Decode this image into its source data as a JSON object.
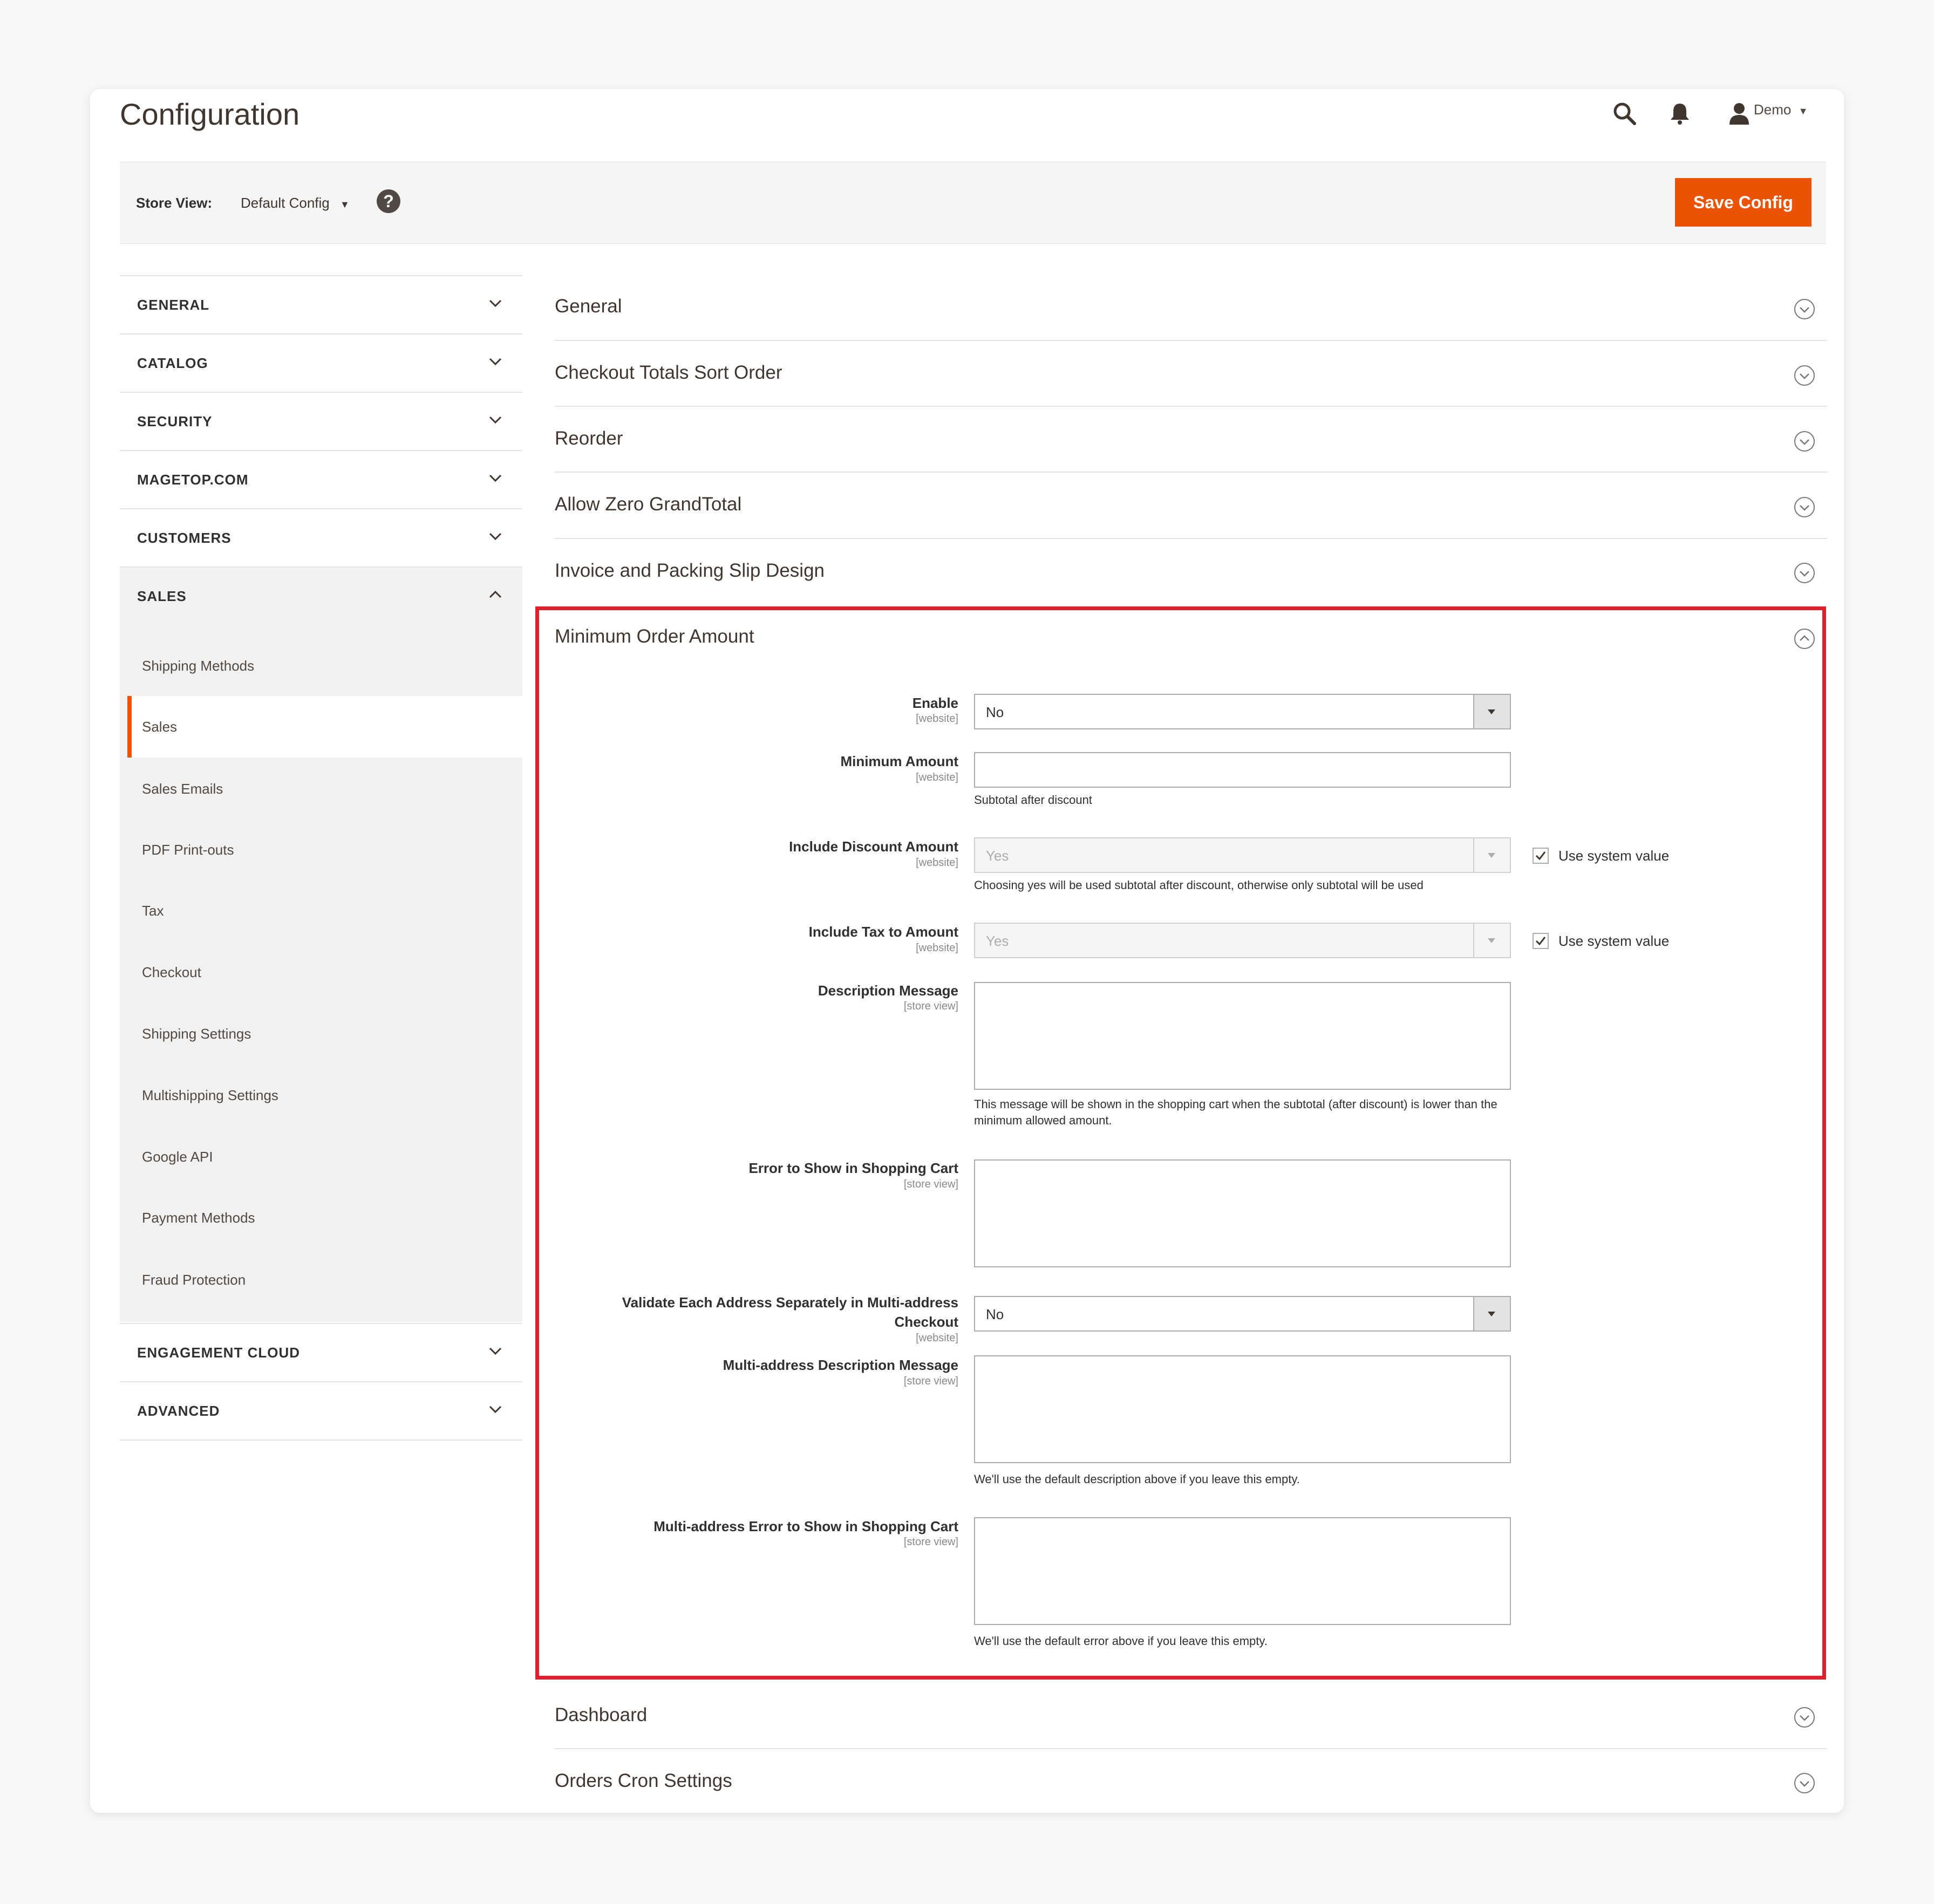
{
  "header": {
    "title": "Configuration",
    "user": "Demo",
    "icons": [
      "search-icon",
      "bell-icon",
      "user-icon"
    ]
  },
  "toolbar": {
    "store_view_label": "Store View:",
    "store_view_value": "Default Config",
    "save_label": "Save Config",
    "accent": "#eb5202"
  },
  "sidebar": {
    "top_items": [
      "GENERAL",
      "CATALOG",
      "SECURITY",
      "MAGETOP.COM",
      "CUSTOMERS",
      "SALES"
    ],
    "sub_items": [
      "Shipping Methods",
      "Sales",
      "Sales Emails",
      "PDF Print-outs",
      "Tax",
      "Checkout",
      "Shipping Settings",
      "Multishipping Settings",
      "Google API",
      "Payment Methods",
      "Fraud Protection"
    ],
    "active_sub": "Sales",
    "bottom_items": [
      "ENGAGEMENT CLOUD",
      "ADVANCED"
    ]
  },
  "sections": {
    "before": [
      "General",
      "Checkout Totals Sort Order",
      "Reorder",
      "Allow Zero GrandTotal",
      "Invoice and Packing Slip Design"
    ],
    "open": "Minimum Order Amount",
    "after": [
      "Dashboard",
      "Orders Cron Settings"
    ]
  },
  "form": {
    "enable": {
      "label": "Enable",
      "scope": "[website]",
      "value": "No"
    },
    "minimum_amount": {
      "label": "Minimum Amount",
      "scope": "[website]",
      "value": "",
      "note": "Subtotal after discount"
    },
    "include_discount": {
      "label": "Include Discount Amount",
      "scope": "[website]",
      "value": "Yes",
      "note": "Choosing yes will be used subtotal after discount, otherwise only subtotal will be used",
      "use_system": "Use system value"
    },
    "include_tax": {
      "label": "Include Tax to Amount",
      "scope": "[website]",
      "value": "Yes",
      "use_system": "Use system value"
    },
    "description": {
      "label": "Description Message",
      "scope": "[store view]",
      "note": "This message will be shown in the shopping cart when the subtotal (after discount) is lower than the minimum allowed amount."
    },
    "error_cart": {
      "label": "Error to Show in Shopping Cart",
      "scope": "[store view]"
    },
    "validate_each": {
      "label_line1": "Validate Each Address Separately in Multi-address",
      "label_line2": "Checkout",
      "scope": "[website]",
      "value": "No"
    },
    "multi_description": {
      "label": "Multi-address Description Message",
      "scope": "[store view]",
      "note": "We'll use the default description above if you leave this empty."
    },
    "multi_error": {
      "label": "Multi-address Error to Show in Shopping Cart",
      "scope": "[store view]",
      "note": "We'll use the default error above if you leave this empty."
    }
  }
}
